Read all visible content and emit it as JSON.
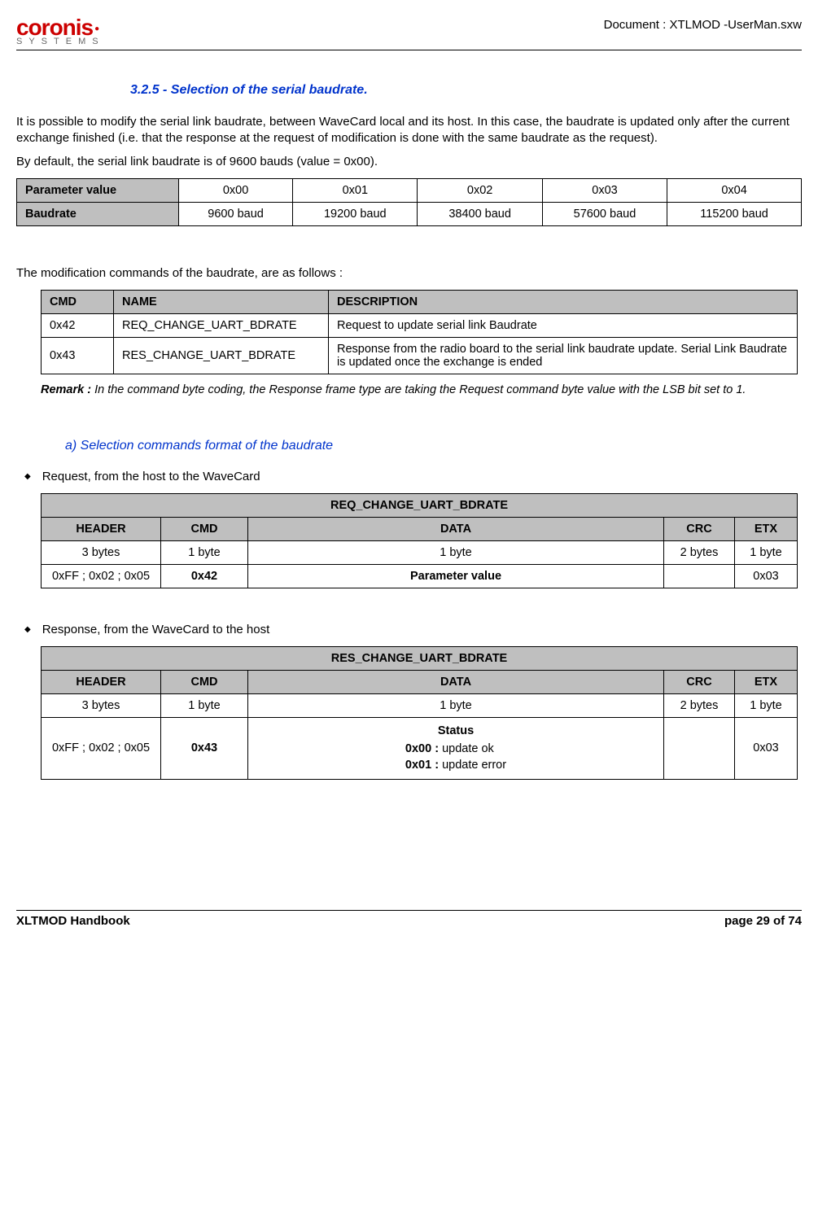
{
  "header": {
    "doc_title": "Document : XTLMOD -UserMan.sxw",
    "logo_top": "coronis",
    "logo_bottom": "SYSTEMS"
  },
  "section": {
    "number": "3.2.5 - Selection of the serial baudrate."
  },
  "paras": {
    "p1": "It is possible to modify the serial link baudrate, between WaveCard local and its host. In this case, the baudrate is updated only after the current exchange finished (i.e. that the response at the request of modification is done with the same baudrate as the request).",
    "p2": "By default, the serial link baudrate is of 9600 bauds (value = 0x00).",
    "p3": "The modification commands of the baudrate, are as follows :"
  },
  "table1": {
    "row1_label": "Parameter value",
    "row1": [
      "0x00",
      "0x01",
      "0x02",
      "0x03",
      "0x04"
    ],
    "row2_label": "Baudrate",
    "row2": [
      "9600 baud",
      "19200 baud",
      "38400 baud",
      "57600 baud",
      "115200 baud"
    ]
  },
  "table2": {
    "headers": [
      "CMD",
      "NAME",
      "DESCRIPTION"
    ],
    "rows": [
      [
        "0x42",
        "REQ_CHANGE_UART_BDRATE",
        "Request to update serial link Baudrate"
      ],
      [
        "0x43",
        "RES_CHANGE_UART_BDRATE",
        "Response from the radio board to the serial link baudrate update. Serial Link Baudrate is updated once the exchange  is ended"
      ]
    ]
  },
  "remark": {
    "label": "Remark :",
    "text": " In the command byte coding, the Response frame type are taking the Request command byte value with the LSB bit set to 1."
  },
  "subsection": {
    "a": "a) Selection commands format of the baudrate"
  },
  "bullets": {
    "req": "Request, from the host to the WaveCard",
    "res": "Response, from the WaveCard to the host"
  },
  "table3": {
    "title": "REQ_CHANGE_UART_BDRATE",
    "headers": [
      "HEADER",
      "CMD",
      "DATA",
      "CRC",
      "ETX"
    ],
    "sizes": [
      "3 bytes",
      "1 byte",
      "1 byte",
      "2 bytes",
      "1 byte"
    ],
    "values": [
      "0xFF ; 0x02 ; 0x05",
      "0x42",
      "Parameter value",
      "",
      "0x03"
    ]
  },
  "table4": {
    "title": "RES_CHANGE_UART_BDRATE",
    "headers": [
      "HEADER",
      "CMD",
      "DATA",
      "CRC",
      "ETX"
    ],
    "sizes": [
      "3 bytes",
      "1 byte",
      "1 byte",
      "2 bytes",
      "1 byte"
    ],
    "values_header": "0xFF ; 0x02 ; 0x05",
    "values_cmd": "0x43",
    "status_title": "Status",
    "status_ok_k": "0x00 :",
    "status_ok_v": " update ok",
    "status_err_k": "0x01 :",
    "status_err_v": " update error",
    "values_crc": "",
    "values_etx": "0x03"
  },
  "footer": {
    "left": "XLTMOD Handbook",
    "right": "page 29 of 74"
  }
}
